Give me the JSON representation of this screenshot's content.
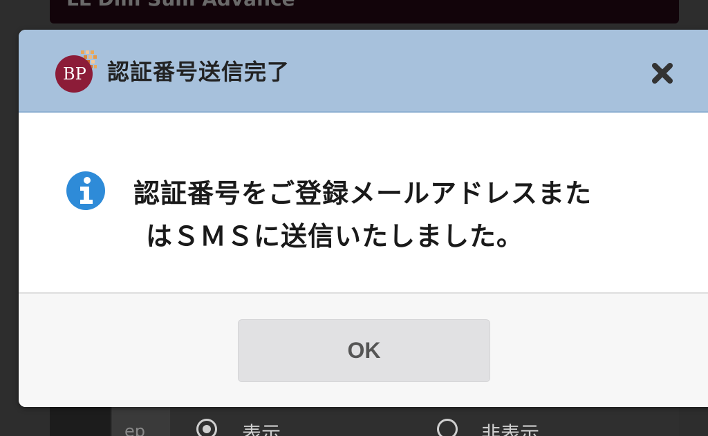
{
  "background": {
    "top_bar_text": "LL Dim Sum Advance",
    "bottom_cell_text": "ep",
    "radio_options": [
      {
        "label": "表示",
        "checked": true
      },
      {
        "label": "非表示",
        "checked": false
      }
    ]
  },
  "dialog": {
    "title": "認証番号送信完了",
    "logo_text": "BP",
    "message_line1": "認証番号をご登録メールアドレスまた",
    "message_line2": "はＳＭＳに送信いたしました。",
    "ok_label": "OK",
    "icons": {
      "logo": "bp-logo-icon",
      "close": "close-icon",
      "info": "info-icon"
    },
    "colors": {
      "header_bg": "#a7c1dc",
      "info_blue": "#2e8bd8",
      "logo_red": "#8c1c38",
      "button_bg": "#e1e1e3"
    }
  }
}
